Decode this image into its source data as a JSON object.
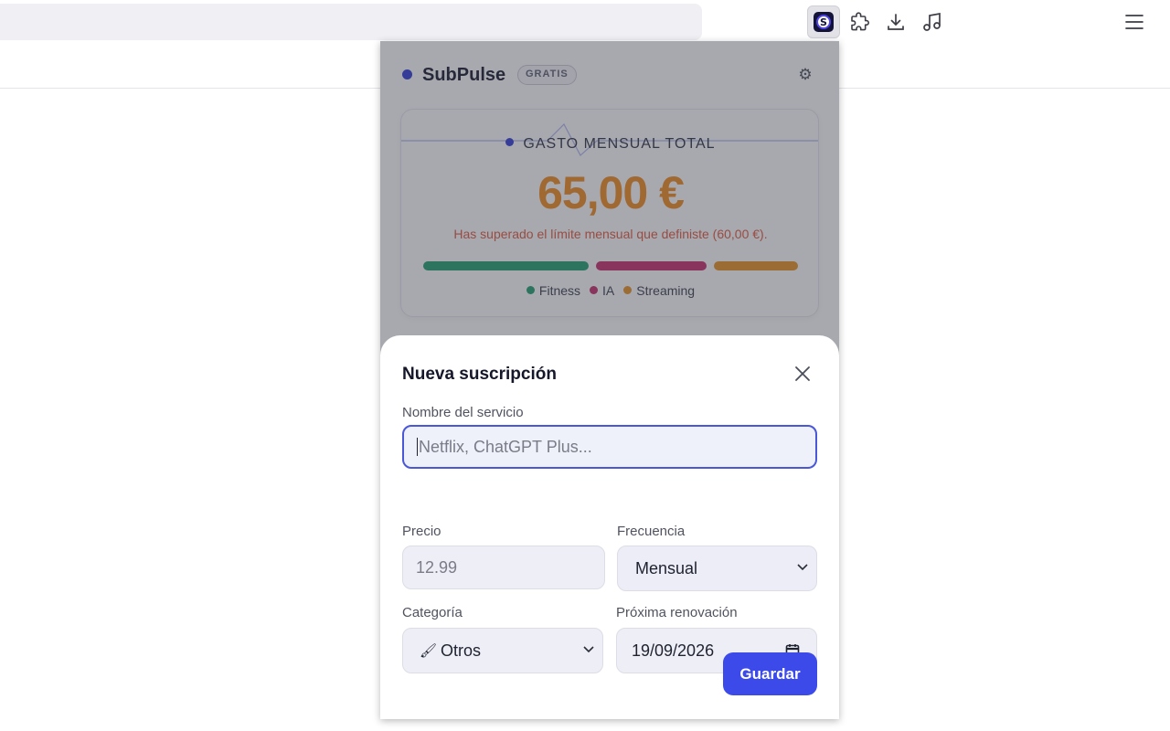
{
  "browser": {
    "toolbar": [
      "extension-subpulse",
      "extensions",
      "downloads",
      "media",
      "menu"
    ]
  },
  "popup": {
    "brand": "SubPulse",
    "plan_badge": "GRATIS",
    "card": {
      "title": "GASTO MENSUAL TOTAL",
      "total": "65,00 €",
      "warning": "Has superado el límite mensual que definiste (60,00 €).",
      "breakdown": [
        {
          "name": "Fitness",
          "color": "#1e9e6a",
          "share": 0.45
        },
        {
          "name": "IA",
          "color": "#c72a6a",
          "share": 0.3
        },
        {
          "name": "Streaming",
          "color": "#e8901f",
          "share": 0.23
        }
      ]
    },
    "modal": {
      "title": "Nueva suscripción",
      "service_label": "Nombre del servicio",
      "service_placeholder": "Netflix, ChatGPT Plus...",
      "price_label": "Precio",
      "price_placeholder": "12.99",
      "frequency_label": "Frecuencia",
      "frequency_value": "Mensual",
      "category_label": "Categoría",
      "category_value": "Otros",
      "category_icon": "🖌",
      "renewal_label": "Próxima renovación",
      "renewal_value": "19/09/2026",
      "save_label": "Guardar"
    }
  }
}
